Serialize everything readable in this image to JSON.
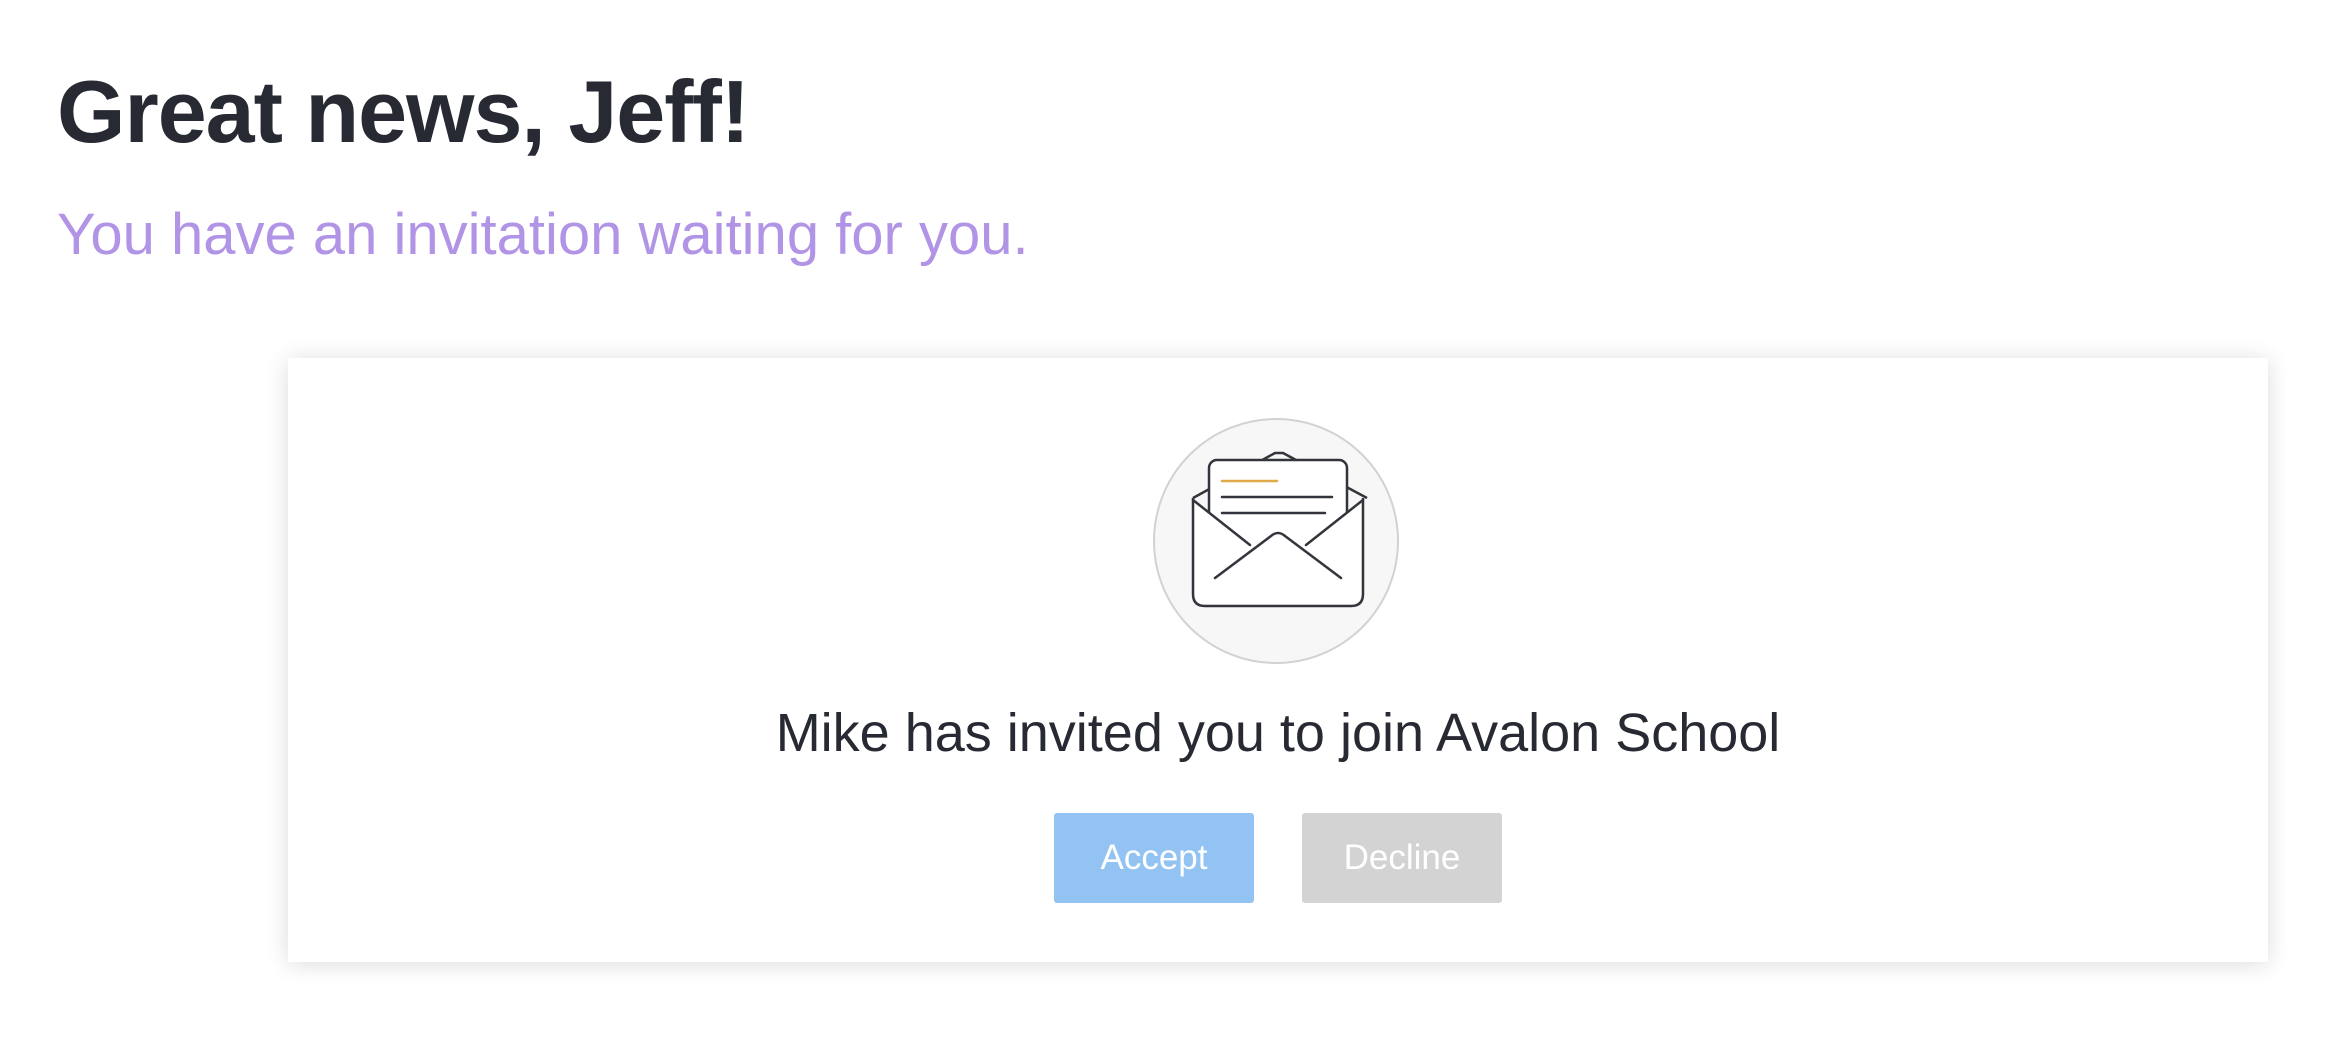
{
  "header": {
    "title": "Great news, Jeff!",
    "subtitle": "You have an invitation waiting for you."
  },
  "invitation": {
    "icon": "open-envelope-icon",
    "message": "Mike has invited you to join Avalon School",
    "accept_label": "Accept",
    "decline_label": "Decline"
  },
  "colors": {
    "title": "#272a33",
    "subtitle": "#b194e6",
    "accept": "#92c3f2",
    "decline": "#d3d3d3",
    "letter_accent": "#e0a94a"
  }
}
